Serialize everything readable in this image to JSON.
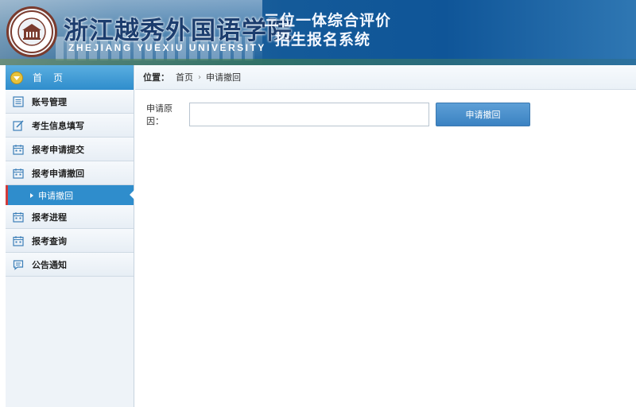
{
  "header": {
    "school_name_cn": "浙江越秀外国语学院",
    "school_name_en": "ZHEJIANG  YUEXIU  UNIVERSITY",
    "system_title_line1": "三位一体综合评价",
    "system_title_line2": "招生报名系统",
    "logo_icon": "university-seal-icon"
  },
  "sidebar": {
    "home": {
      "label": "首页",
      "icon": "chevron-down-circle-icon"
    },
    "items": [
      {
        "label": "账号管理",
        "icon": "list-icon"
      },
      {
        "label": "考生信息填写",
        "icon": "edit-icon"
      },
      {
        "label": "报考申请提交",
        "icon": "calendar-icon"
      },
      {
        "label": "报考申请撤回",
        "icon": "calendar-icon"
      },
      {
        "label": "报考进程",
        "icon": "calendar-icon"
      },
      {
        "label": "报考查询",
        "icon": "calendar-icon"
      },
      {
        "label": "公告通知",
        "icon": "message-icon"
      }
    ],
    "active_sub": {
      "label": "申请撤回"
    }
  },
  "breadcrumb": {
    "label": "位置：",
    "home": "首页",
    "separator": "›",
    "current": "申请撤回"
  },
  "form": {
    "reason_label": "申请原因：",
    "reason_value": "",
    "reason_placeholder": "",
    "submit_label": "申请撤回"
  },
  "colors": {
    "header_blue": "#145a99",
    "sidebar_active": "#2f8dcc",
    "active_marker": "#d23a3a",
    "button_blue": "#3b82c2"
  }
}
